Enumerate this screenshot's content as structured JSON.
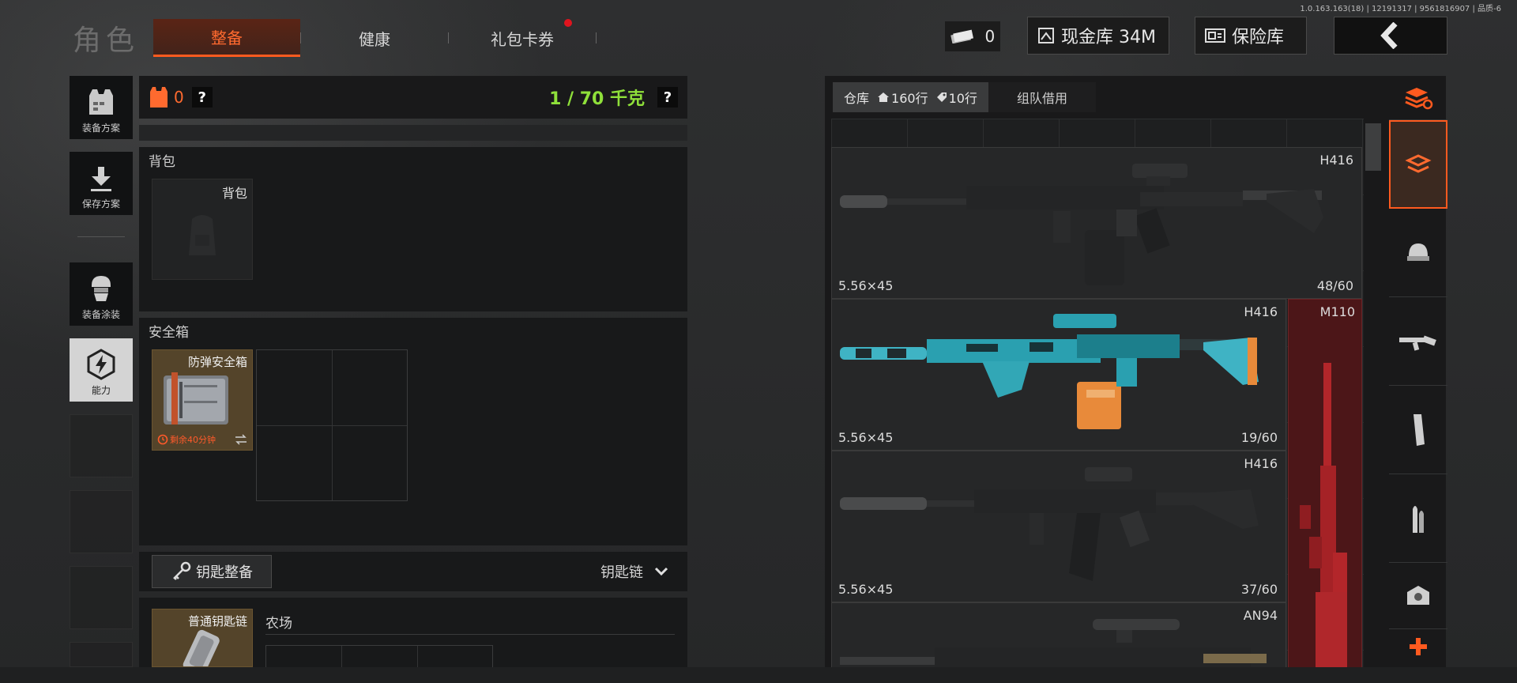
{
  "version": "1.0.163.163(18) | 12191317 | 9561816907 | 品质-6",
  "header": {
    "title": "角色",
    "tabs": [
      {
        "label": "整备",
        "active": true
      },
      {
        "label": "健康",
        "active": false
      },
      {
        "label": "礼包卡券",
        "active": false,
        "badge": true
      }
    ],
    "cash_value": "0",
    "cash_vault_label": "现金库 34M",
    "insurance_vault_label": "保险库"
  },
  "sidebar": {
    "items": [
      {
        "label": "装备方案",
        "icon": "vest-icon"
      },
      {
        "label": "保存方案",
        "icon": "download-icon"
      },
      {
        "label": "装备涂装",
        "icon": "helmet-mask-icon"
      },
      {
        "label": "能力",
        "icon": "lightning-hex-icon",
        "active": true
      }
    ]
  },
  "loadout": {
    "armor_count": "0",
    "help_mark": "?",
    "weight": "1 / 70 千克",
    "backpack_section": "背包",
    "backpack_slot_label": "背包",
    "safebox_section": "安全箱",
    "safebox_name": "防弹安全箱",
    "safebox_timer": "剩余40分钟",
    "key_button": "钥匙整备",
    "keychain_dropdown": "钥匙链",
    "keychain_item": "普通钥匙链",
    "farm_label": "农场"
  },
  "storage": {
    "tab_storage": "仓库",
    "tab_rows_a": "160行",
    "tab_rows_b": "10行",
    "tab_team": "组队借用",
    "weapons": [
      {
        "name": "H416",
        "caliber": "5.56×45",
        "ammo": "48/60"
      },
      {
        "name": "H416",
        "caliber": "5.56×45",
        "ammo": "19/60"
      },
      {
        "name": "M110",
        "caliber": "",
        "ammo": ""
      },
      {
        "name": "H416",
        "caliber": "5.56×45",
        "ammo": "37/60"
      },
      {
        "name": "AN94",
        "caliber": "",
        "ammo": ""
      }
    ]
  },
  "colors": {
    "accent": "#ff5a1f",
    "weight_green": "#8fe03a",
    "m110_red": "#5a1417"
  }
}
